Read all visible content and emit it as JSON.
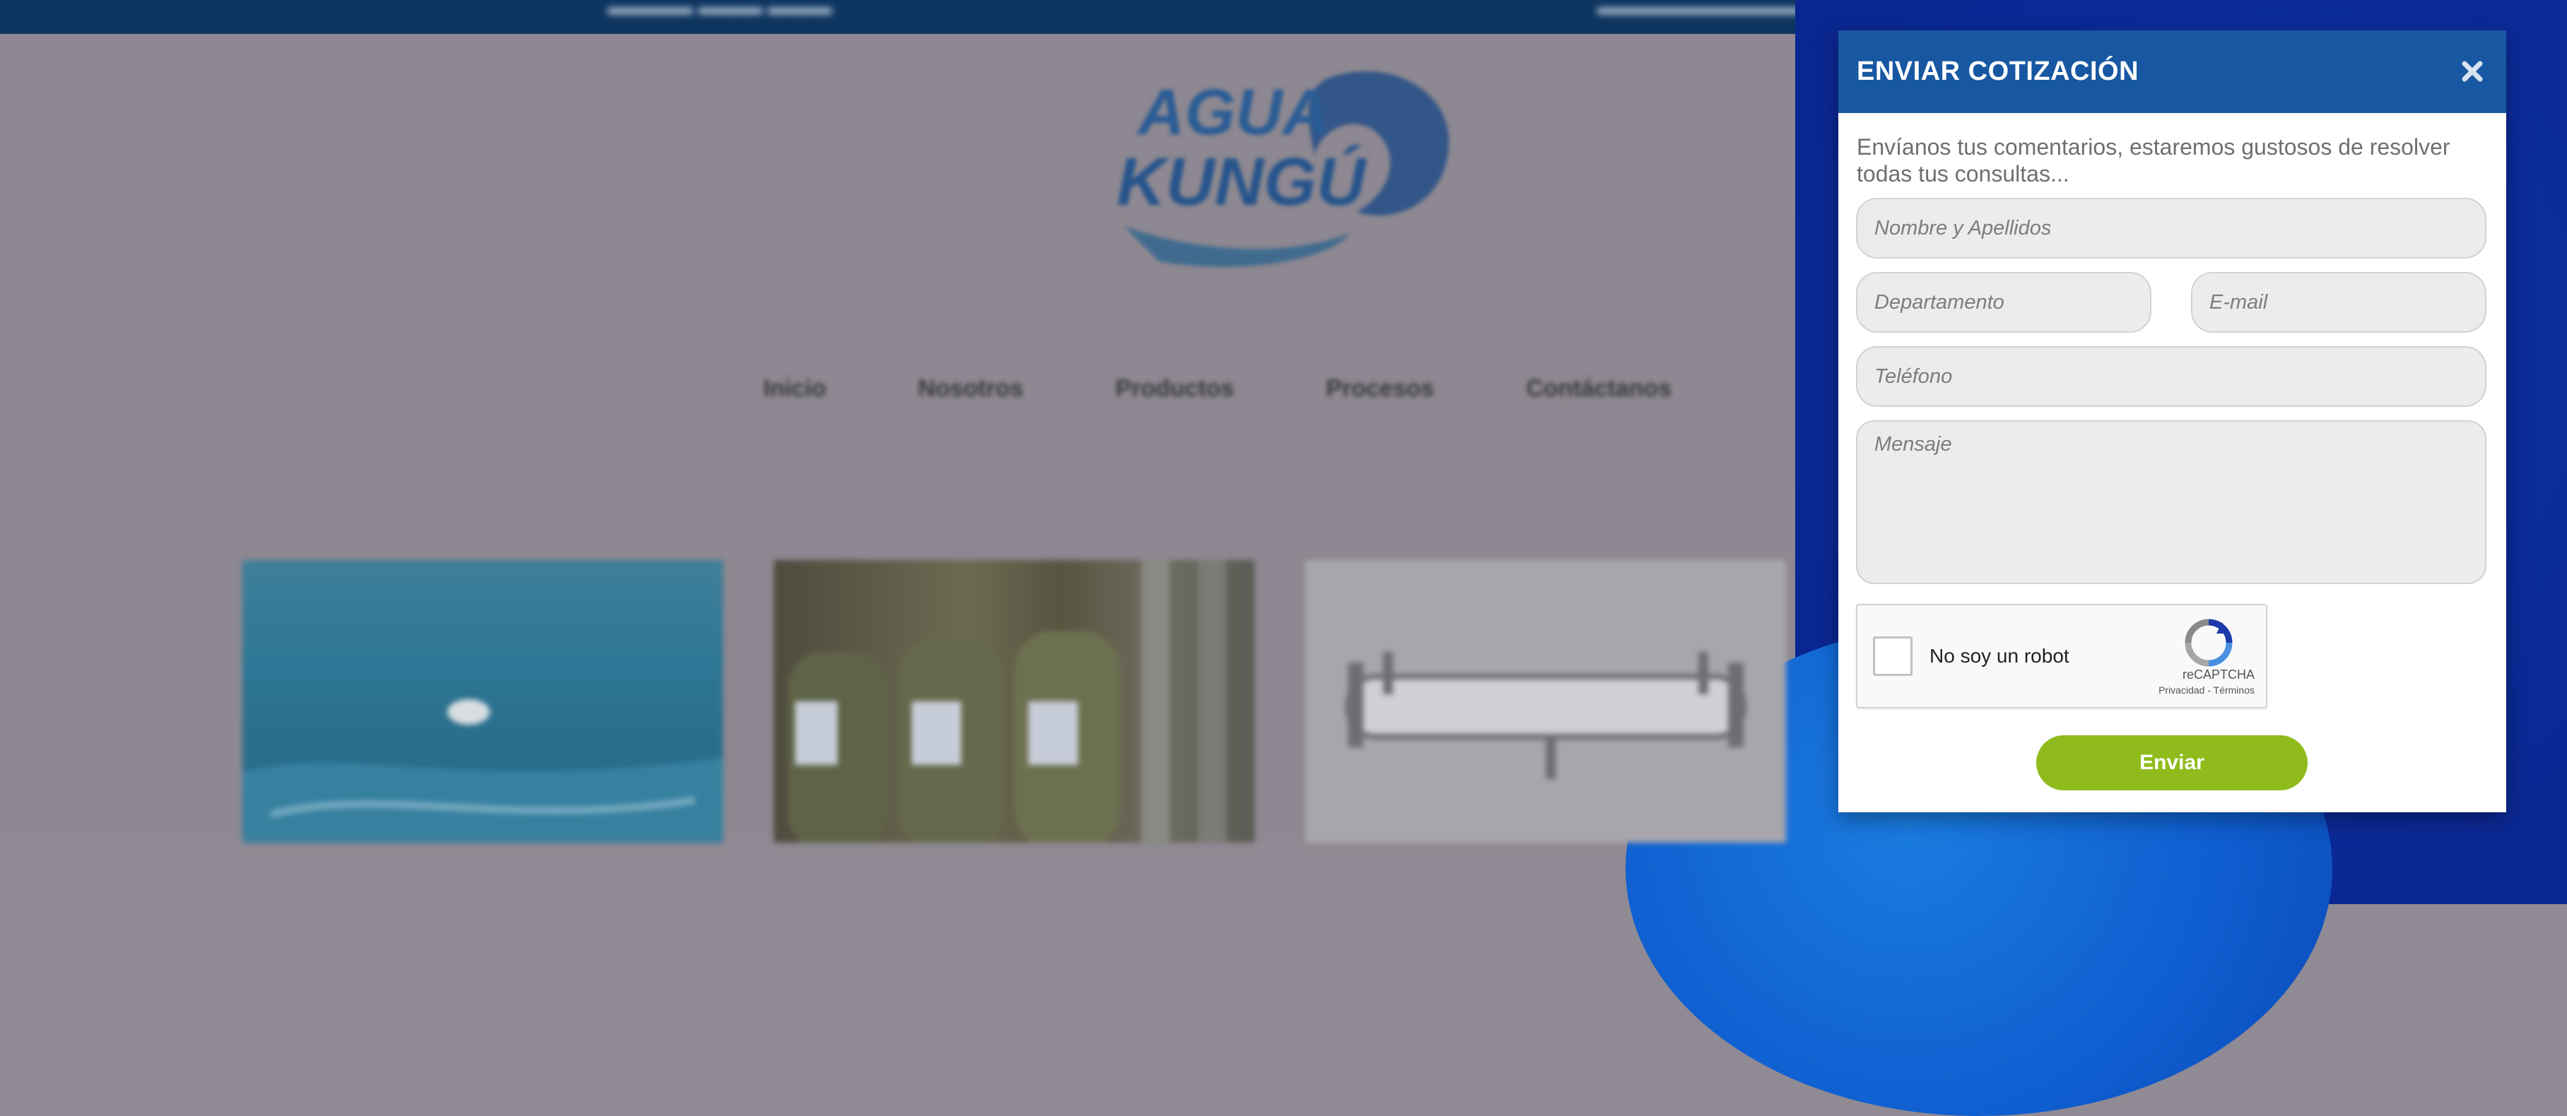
{
  "modal": {
    "title": "ENVIAR COTIZACIÓN",
    "description": "Envíanos tus comentarios, estaremos gustosos de resolver todas tus consultas...",
    "fields": {
      "name_placeholder": "Nombre y Apellidos",
      "department_placeholder": "Departamento",
      "email_placeholder": "E-mail",
      "phone_placeholder": "Teléfono",
      "message_placeholder": "Mensaje"
    },
    "captcha": {
      "label": "No soy un robot",
      "brand": "reCAPTCHA",
      "privacy": "Privacidad",
      "separator": "-",
      "terms": "Términos"
    },
    "submit_label": "Enviar"
  },
  "background": {
    "logo_line1": "AGUA",
    "logo_line2": "KUNGÚ",
    "nav": [
      "Inicio",
      "Nosotros",
      "Productos",
      "Procesos",
      "Contáctanos"
    ]
  },
  "colors": {
    "modal_header": "#1857a2",
    "submit_button": "#8fbc1c",
    "overlay": "#8d8891",
    "top_bar": "#0e3560"
  }
}
